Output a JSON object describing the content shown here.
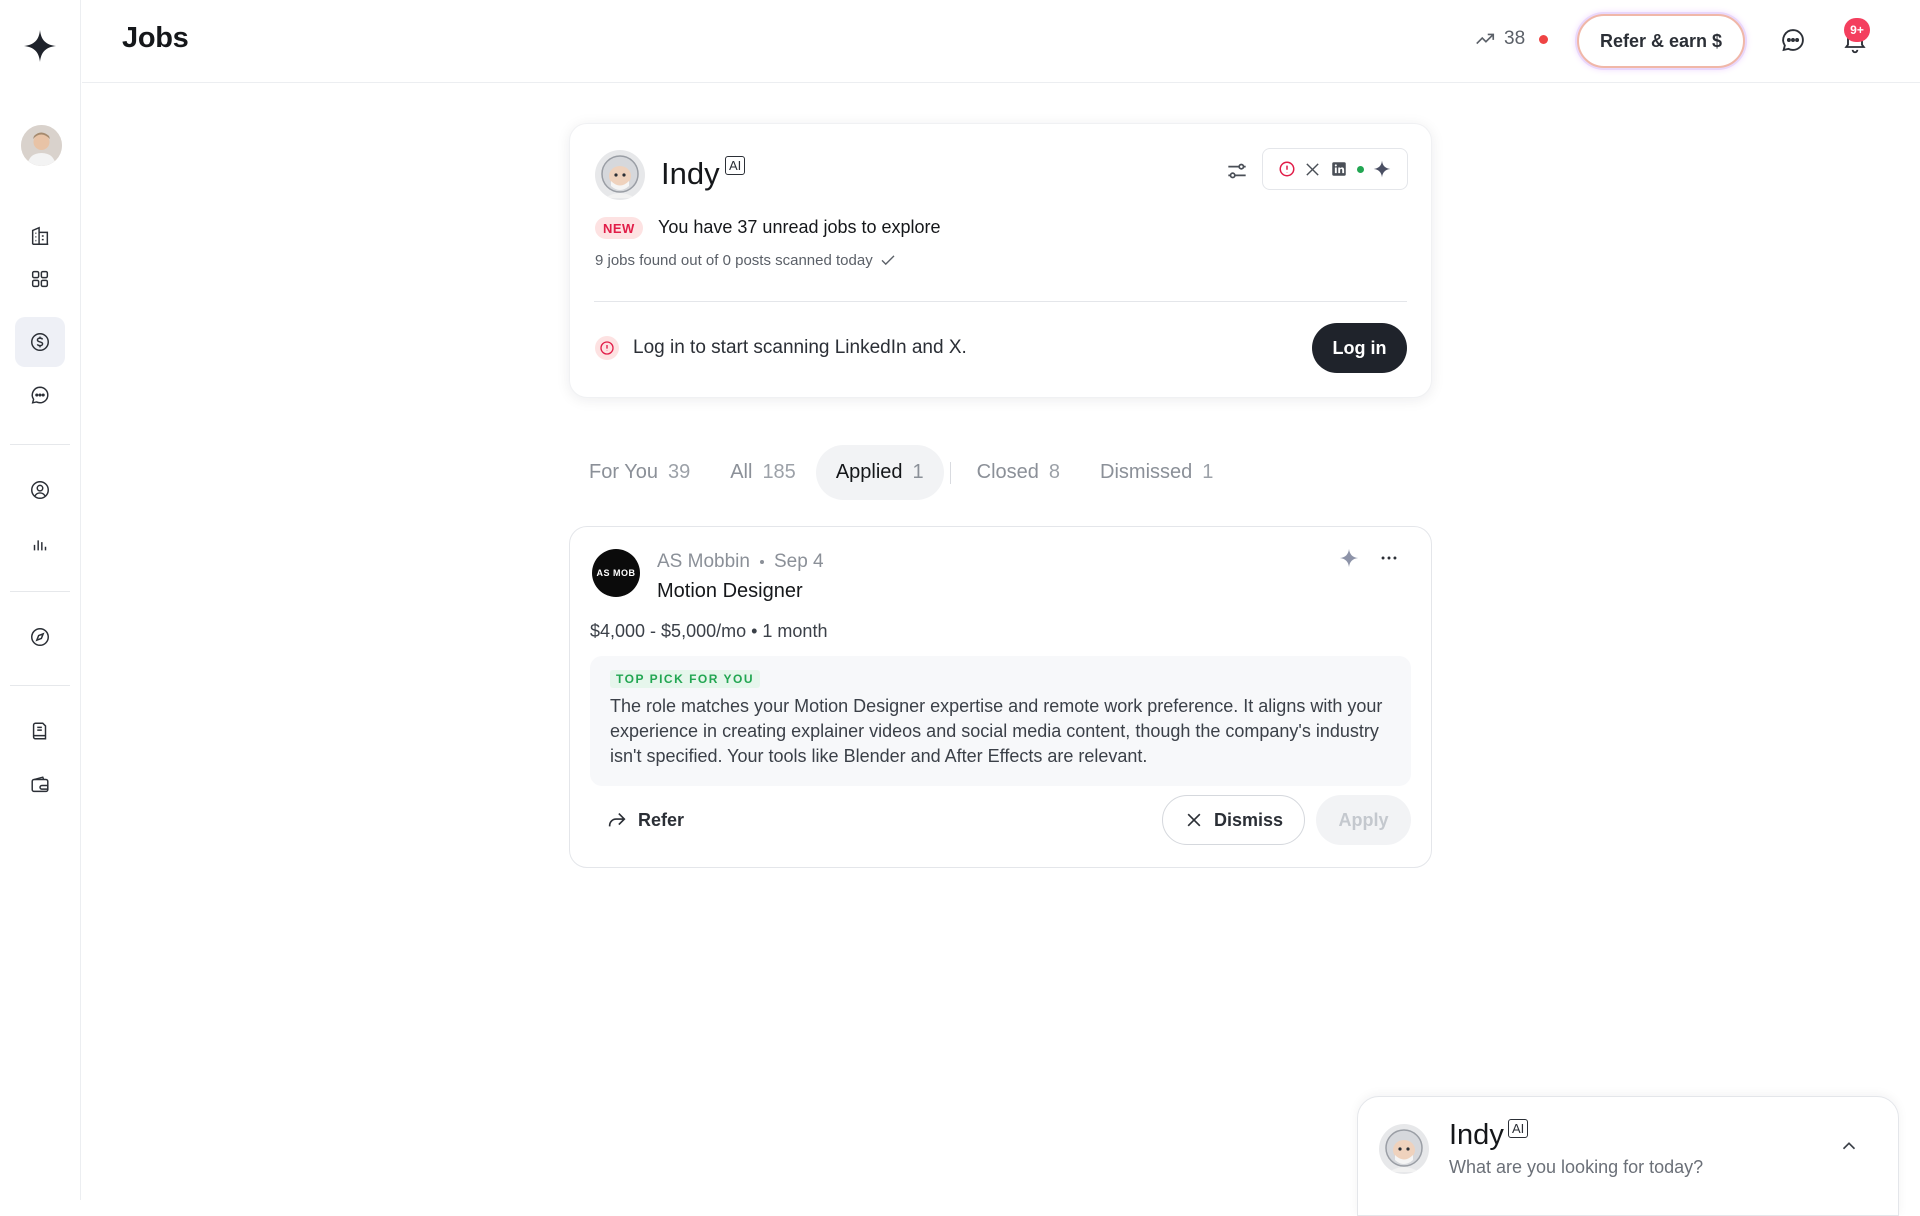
{
  "header": {
    "title": "Jobs",
    "streak_count": "38",
    "refer_label": "Refer & earn $",
    "notification_badge": "9+"
  },
  "indy_card": {
    "name": "Indy",
    "ai_tag": "AI",
    "new_label": "NEW",
    "unread_text": "You have 37 unread jobs to explore",
    "scanned_text": "9 jobs found out of 0 posts scanned today",
    "login_message": "Log in to start scanning LinkedIn and X.",
    "login_button": "Log in"
  },
  "tabs": [
    {
      "label": "For You",
      "count": "39"
    },
    {
      "label": "All",
      "count": "185"
    },
    {
      "label": "Applied",
      "count": "1"
    },
    {
      "label": "Closed",
      "count": "8"
    },
    {
      "label": "Dismissed",
      "count": "1"
    }
  ],
  "job": {
    "logo_text": "AS MOB",
    "company": "AS Mobbin",
    "date": "Sep 4",
    "title": "Motion Designer",
    "pay": "$4,000 - $5,000/mo • 1 month",
    "pick_label": "TOP PICK FOR YOU",
    "pick_text": "The role matches your Motion Designer expertise and remote work preference. It aligns with your experience in creating explainer videos and social media content, though the company's industry isn't specified. Your tools like Blender and After Effects are relevant.",
    "refer_label": "Refer",
    "dismiss_label": "Dismiss",
    "apply_label": "Apply"
  },
  "chat_dock": {
    "name": "Indy",
    "ai_tag": "AI",
    "prompt": "What are you looking for today?"
  },
  "colors": {
    "accent_dark": "#1f232b",
    "new_red": "#e11d48",
    "pick_green": "#22a652",
    "active_nav_bg": "#eef0f6"
  },
  "icons": {
    "logo": "four-point-star-icon",
    "nav": [
      "building-icon",
      "grid-icon",
      "dollar-icon",
      "chat-icon",
      "user-circle-icon",
      "bar-chart-icon",
      "compass-icon",
      "document-icon",
      "wallet-icon"
    ]
  }
}
